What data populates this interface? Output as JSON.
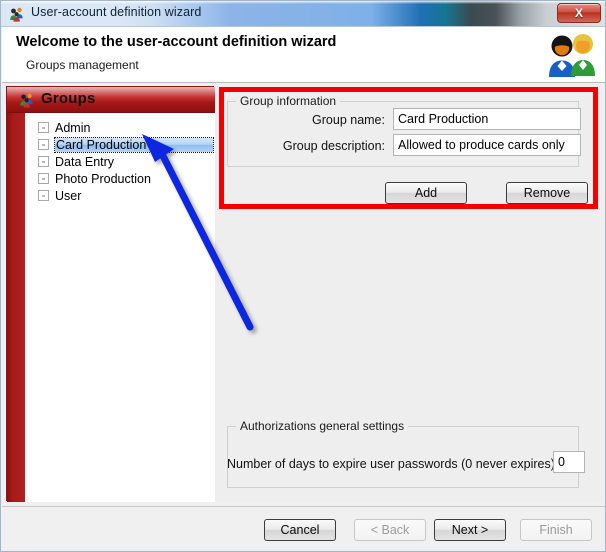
{
  "window": {
    "title": "User-account definition wizard",
    "title_icon": "group-people-icon",
    "close_label": "X"
  },
  "header": {
    "title": "Welcome to the user-account definition wizard",
    "subtitle": "Groups management",
    "icon": "two-people-icon"
  },
  "sidebar": {
    "title": "Groups",
    "icon": "group-people-icon",
    "items": [
      {
        "label": "Admin",
        "checked": false,
        "selected": false
      },
      {
        "label": "Card Production",
        "checked": false,
        "selected": true
      },
      {
        "label": "Data Entry",
        "checked": false,
        "selected": false
      },
      {
        "label": "Photo Production",
        "checked": false,
        "selected": false
      },
      {
        "label": "User",
        "checked": false,
        "selected": false
      }
    ]
  },
  "group_information": {
    "legend": "Group information",
    "name_label": "Group name:",
    "name_value": "Card Production",
    "description_label": "Group description:",
    "description_value": "Allowed to produce cards only",
    "add_label": "Add",
    "remove_label": "Remove"
  },
  "authorizations": {
    "legend": "Authorizations general settings",
    "days_label": "Number of days to expire user passwords (0 never expires):",
    "days_value": "0"
  },
  "footer": {
    "cancel_label": "Cancel",
    "back_label": "< Back",
    "next_label": "Next >",
    "finish_label": "Finish"
  },
  "annotations": {
    "highlight_color": "#f50000",
    "arrow_color": "#0b28e0"
  }
}
